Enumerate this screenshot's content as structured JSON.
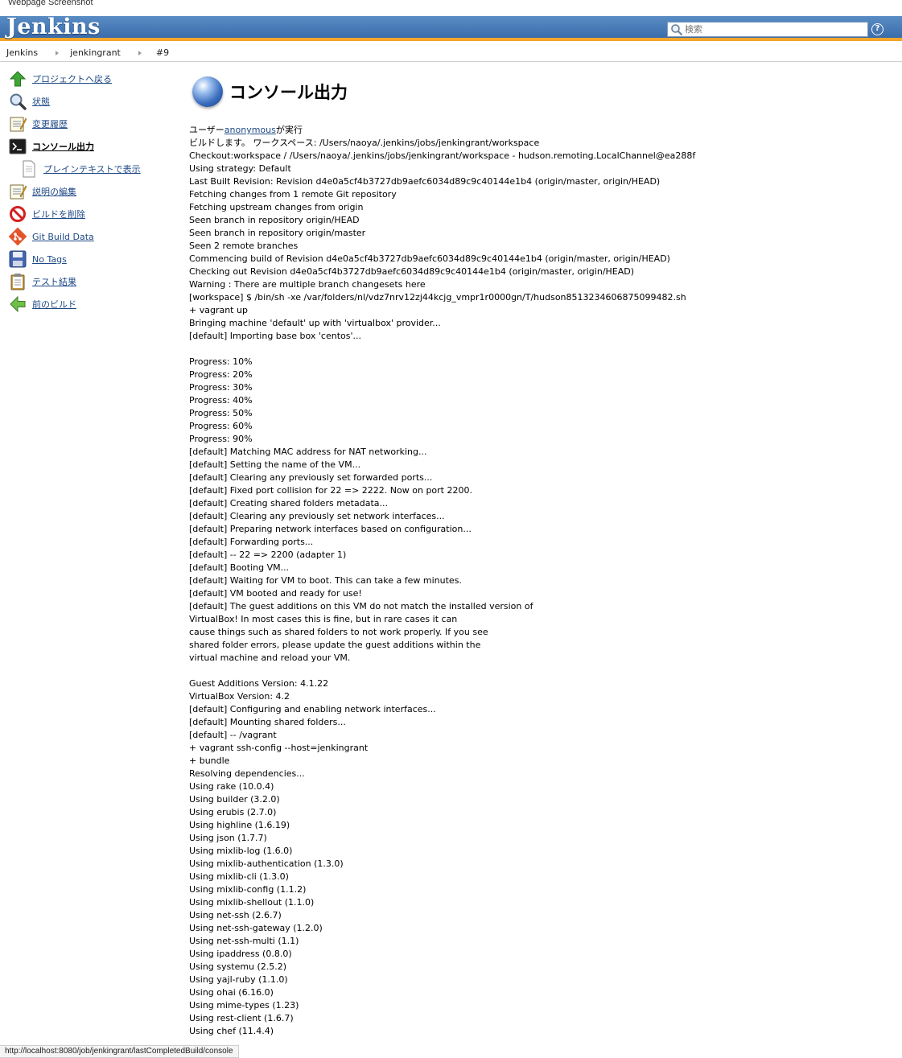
{
  "window": {
    "title": "Webpage Screenshot"
  },
  "header": {
    "logo": "Jenkins",
    "search_placeholder": "検索",
    "help": "?"
  },
  "breadcrumb": [
    "Jenkins",
    "jenkingrant",
    "#9"
  ],
  "sidebar": {
    "items": [
      {
        "label": "プロジェクトへ戻る",
        "icon": "up-arrow-icon"
      },
      {
        "label": "状態",
        "icon": "magnifier-icon"
      },
      {
        "label": "変更履歴",
        "icon": "notepad-icon"
      },
      {
        "label": "コンソール出力",
        "icon": "terminal-icon"
      },
      {
        "label": "プレインテキストで表示",
        "icon": "document-icon"
      },
      {
        "label": "説明の編集",
        "icon": "notepad-icon"
      },
      {
        "label": "ビルドを削除",
        "icon": "no-entry-icon"
      },
      {
        "label": "Git Build Data",
        "icon": "git-icon"
      },
      {
        "label": "No Tags",
        "icon": "save-icon"
      },
      {
        "label": "テスト結果",
        "icon": "clipboard-icon"
      },
      {
        "label": "前のビルド",
        "icon": "left-arrow-icon"
      }
    ]
  },
  "main": {
    "title": "コンソール出力",
    "user_prefix": "ユーザー",
    "user_name": "anonymous",
    "user_suffix": "が実行",
    "console_text": "ビルドします。 ワークスペース: /Users/naoya/.jenkins/jobs/jenkingrant/workspace\nCheckout:workspace / /Users/naoya/.jenkins/jobs/jenkingrant/workspace - hudson.remoting.LocalChannel@ea288f\nUsing strategy: Default\nLast Built Revision: Revision d4e0a5cf4b3727db9aefc6034d89c9c40144e1b4 (origin/master, origin/HEAD)\nFetching changes from 1 remote Git repository\nFetching upstream changes from origin\nSeen branch in repository origin/HEAD\nSeen branch in repository origin/master\nSeen 2 remote branches\nCommencing build of Revision d4e0a5cf4b3727db9aefc6034d89c9c40144e1b4 (origin/master, origin/HEAD)\nChecking out Revision d4e0a5cf4b3727db9aefc6034d89c9c40144e1b4 (origin/master, origin/HEAD)\nWarning : There are multiple branch changesets here\n[workspace] $ /bin/sh -xe /var/folders/nl/vdz7nrv12zj44kcjg_vmpr1r0000gn/T/hudson8513234606875099482.sh\n+ vagrant up\nBringing machine 'default' up with 'virtualbox' provider...\n[default] Importing base box 'centos'...\n\nProgress: 10%\nProgress: 20%\nProgress: 30%\nProgress: 40%\nProgress: 50%\nProgress: 60%\nProgress: 90%\n[default] Matching MAC address for NAT networking...\n[default] Setting the name of the VM...\n[default] Clearing any previously set forwarded ports...\n[default] Fixed port collision for 22 => 2222. Now on port 2200.\n[default] Creating shared folders metadata...\n[default] Clearing any previously set network interfaces...\n[default] Preparing network interfaces based on configuration...\n[default] Forwarding ports...\n[default] -- 22 => 2200 (adapter 1)\n[default] Booting VM...\n[default] Waiting for VM to boot. This can take a few minutes.\n[default] VM booted and ready for use!\n[default] The guest additions on this VM do not match the installed version of\nVirtualBox! In most cases this is fine, but in rare cases it can\ncause things such as shared folders to not work properly. If you see\nshared folder errors, please update the guest additions within the\nvirtual machine and reload your VM.\n\nGuest Additions Version: 4.1.22\nVirtualBox Version: 4.2\n[default] Configuring and enabling network interfaces...\n[default] Mounting shared folders...\n[default] -- /vagrant\n+ vagrant ssh-config --host=jenkingrant\n+ bundle\nResolving dependencies...\nUsing rake (10.0.4)\nUsing builder (3.2.0)\nUsing erubis (2.7.0)\nUsing highline (1.6.19)\nUsing json (1.7.7)\nUsing mixlib-log (1.6.0)\nUsing mixlib-authentication (1.3.0)\nUsing mixlib-cli (1.3.0)\nUsing mixlib-config (1.1.2)\nUsing mixlib-shellout (1.1.0)\nUsing net-ssh (2.6.7)\nUsing net-ssh-gateway (1.2.0)\nUsing net-ssh-multi (1.1)\nUsing ipaddress (0.8.0)\nUsing systemu (2.5.2)\nUsing yajl-ruby (1.1.0)\nUsing ohai (6.16.0)\nUsing mime-types (1.23)\nUsing rest-client (1.6.7)\nUsing chef (11.4.4)"
  },
  "status_bar": {
    "url": "http://localhost:8080/job/jenkingrant/lastCompletedBuild/console"
  },
  "colors": {
    "header": "#3a6cab",
    "header_stripe": "#f4a52c",
    "link": "#204a87"
  }
}
